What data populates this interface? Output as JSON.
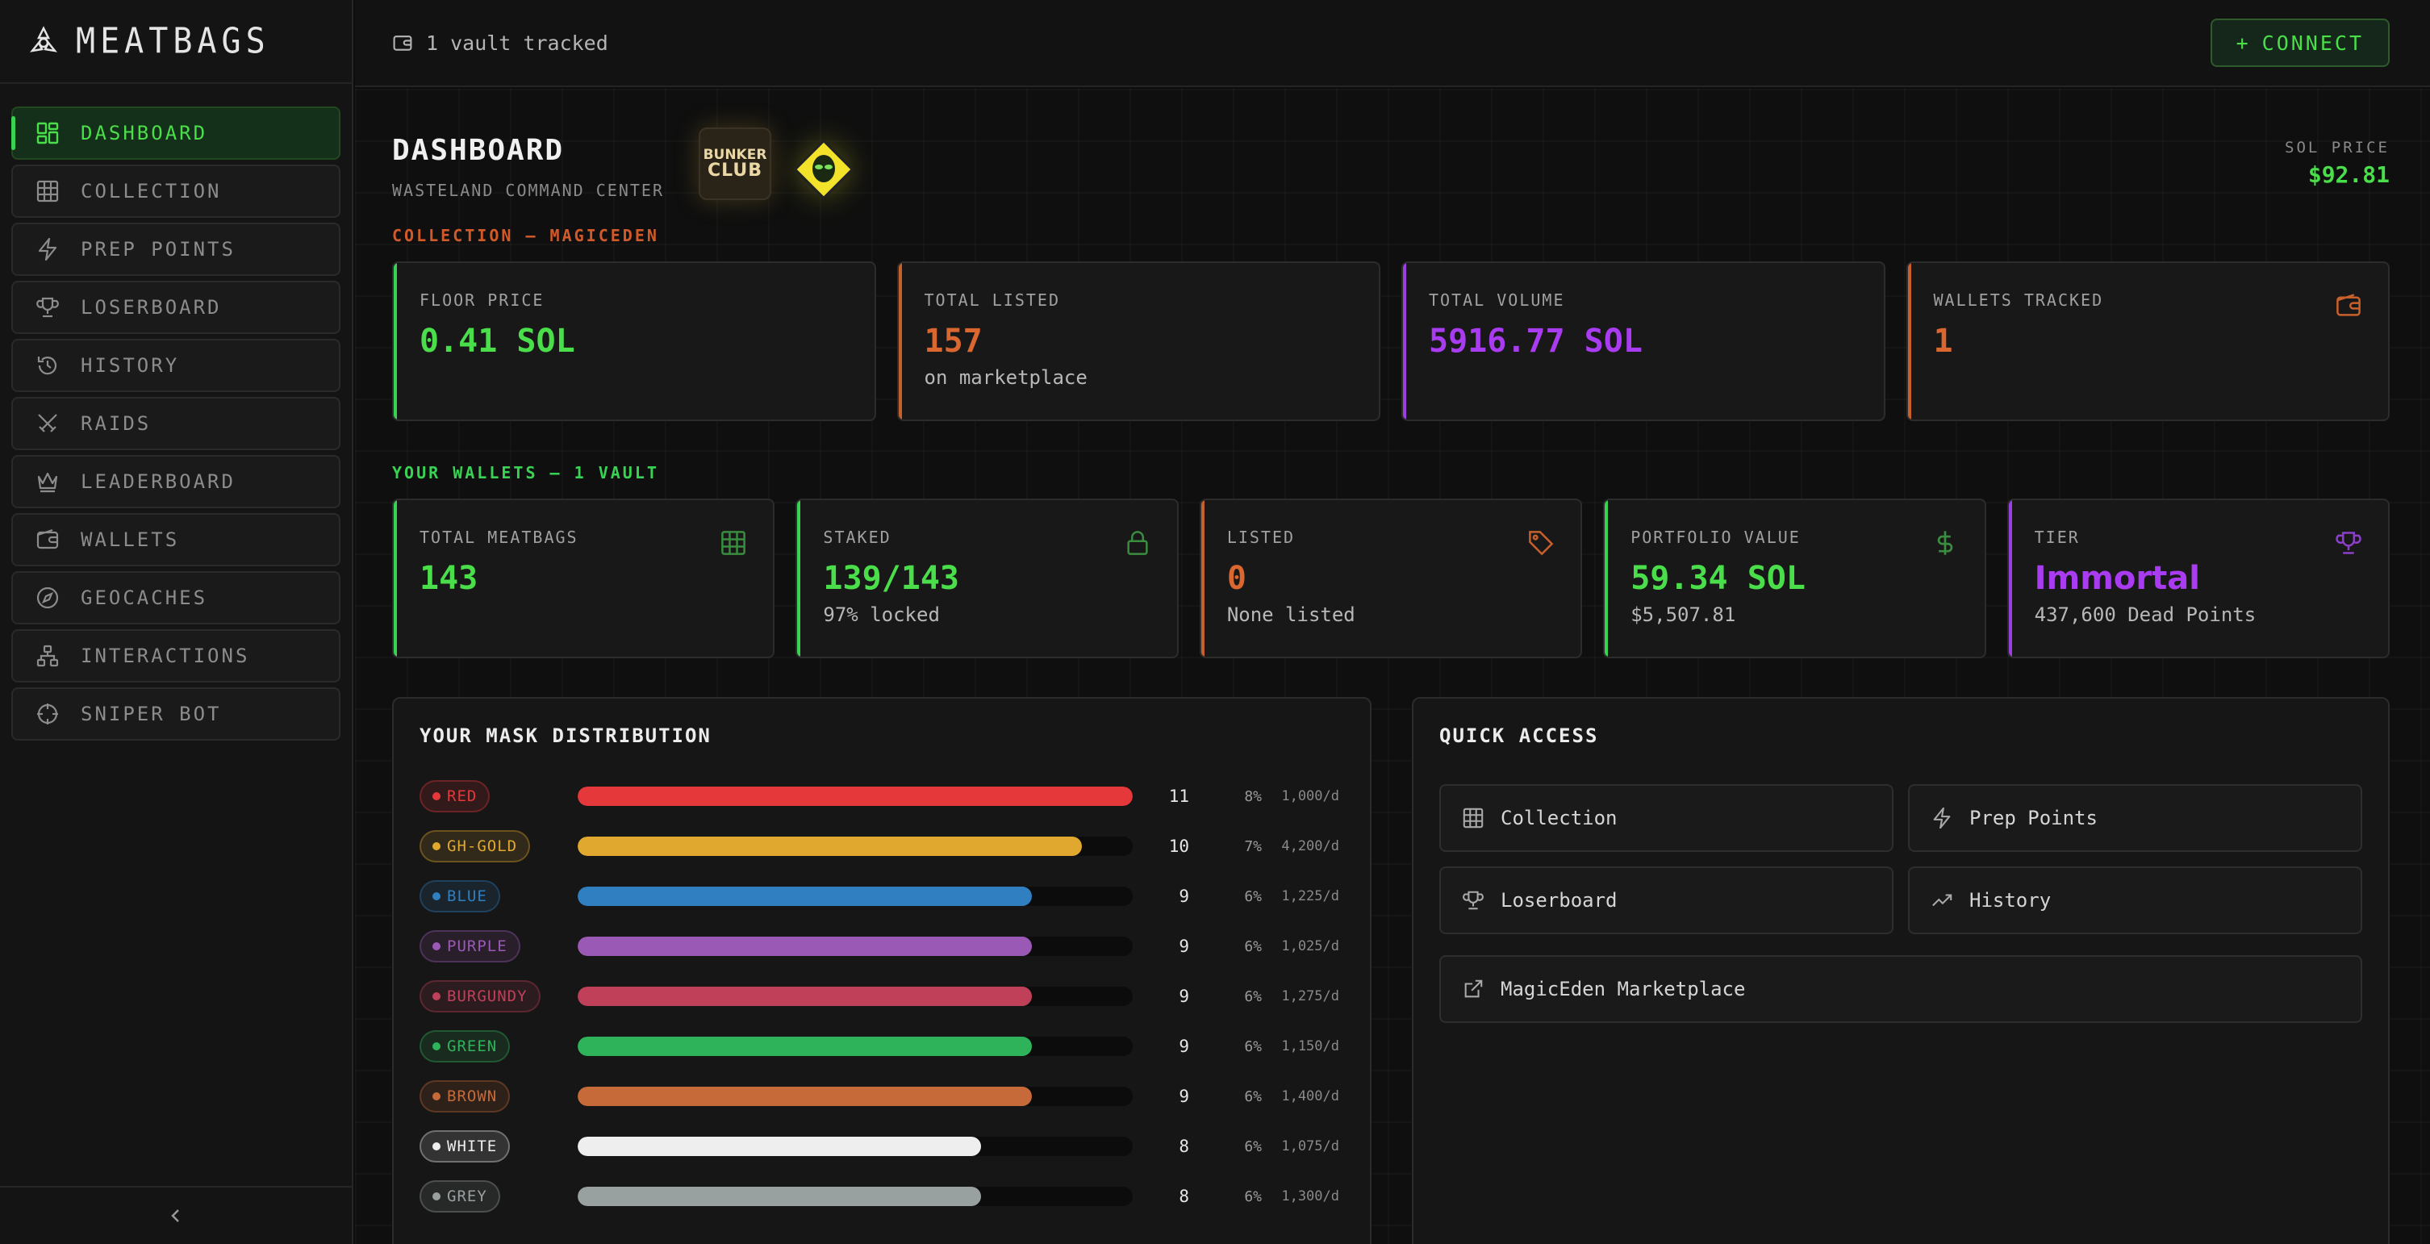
{
  "brand": {
    "name": "MEATBAGS"
  },
  "sidebar": {
    "items": [
      {
        "label": "DASHBOARD",
        "icon": "dashboard-icon",
        "active": true
      },
      {
        "label": "COLLECTION",
        "icon": "grid-icon"
      },
      {
        "label": "PREP POINTS",
        "icon": "lightning-icon"
      },
      {
        "label": "LOSERBOARD",
        "icon": "trophy-icon"
      },
      {
        "label": "HISTORY",
        "icon": "history-icon"
      },
      {
        "label": "RAIDS",
        "icon": "swords-icon"
      },
      {
        "label": "LEADERBOARD",
        "icon": "crown-icon"
      },
      {
        "label": "WALLETS",
        "icon": "wallet-icon"
      },
      {
        "label": "GEOCACHES",
        "icon": "compass-icon"
      },
      {
        "label": "INTERACTIONS",
        "icon": "network-icon"
      },
      {
        "label": "SNIPER BOT",
        "icon": "crosshair-icon"
      }
    ],
    "collapse_icon": "chevron-left-icon"
  },
  "topbar": {
    "vault_text": "1 vault tracked",
    "connect_label": "CONNECT"
  },
  "header": {
    "title": "DASHBOARD",
    "subtitle": "WASTELAND COMMAND CENTER",
    "badge_top": "BUNKER",
    "badge_bottom": "CLUB",
    "sol_price_label": "SOL PRICE",
    "sol_price_value": "$92.81"
  },
  "collection": {
    "section_label": "COLLECTION — MAGICEDEN",
    "cards": [
      {
        "label": "FLOOR PRICE",
        "value": "0.41 SOL",
        "sub": "",
        "accent": "green"
      },
      {
        "label": "TOTAL LISTED",
        "value": "157",
        "sub": "on marketplace",
        "accent": "orange"
      },
      {
        "label": "TOTAL VOLUME",
        "value": "5916.77 SOL",
        "sub": "",
        "accent": "purple"
      },
      {
        "label": "WALLETS TRACKED",
        "value": "1",
        "sub": "",
        "accent": "orange",
        "icon": "wallet-icon"
      }
    ]
  },
  "wallets": {
    "section_label": "YOUR WALLETS — 1 VAULT",
    "cards": [
      {
        "label": "TOTAL MEATBAGS",
        "value": "143",
        "sub": "",
        "accent": "green",
        "icon": "grid-icon"
      },
      {
        "label": "STAKED",
        "value": "139/143",
        "sub": "97% locked",
        "accent": "green",
        "icon": "lock-icon"
      },
      {
        "label": "LISTED",
        "value": "0",
        "sub": "None listed",
        "accent": "orange",
        "icon": "tag-icon"
      },
      {
        "label": "PORTFOLIO VALUE",
        "value": "59.34 SOL",
        "sub": "$5,507.81",
        "accent": "green",
        "icon": "dollar-icon"
      },
      {
        "label": "TIER",
        "value": "Immortal",
        "sub": "437,600 Dead Points",
        "accent": "purple",
        "icon": "trophy-icon"
      }
    ]
  },
  "mask_distribution": {
    "title": "YOUR MASK DISTRIBUTION",
    "max_count": 11,
    "rows": [
      {
        "name": "RED",
        "count": "11",
        "pct": "8%",
        "rate": "1,000/d",
        "color": "#e5383b"
      },
      {
        "name": "GH-GOLD",
        "count": "10",
        "pct": "7%",
        "rate": "4,200/d",
        "color": "#e0a82e"
      },
      {
        "name": "BLUE",
        "count": "9",
        "pct": "6%",
        "rate": "1,225/d",
        "color": "#2f7fc1"
      },
      {
        "name": "PURPLE",
        "count": "9",
        "pct": "6%",
        "rate": "1,025/d",
        "color": "#9b59b6"
      },
      {
        "name": "BURGUNDY",
        "count": "9",
        "pct": "6%",
        "rate": "1,275/d",
        "color": "#c0405a"
      },
      {
        "name": "GREEN",
        "count": "9",
        "pct": "6%",
        "rate": "1,150/d",
        "color": "#2fb35a"
      },
      {
        "name": "BROWN",
        "count": "9",
        "pct": "6%",
        "rate": "1,400/d",
        "color": "#c56a38"
      },
      {
        "name": "WHITE",
        "count": "8",
        "pct": "6%",
        "rate": "1,075/d",
        "color": "#eeeeee"
      },
      {
        "name": "GREY",
        "count": "8",
        "pct": "6%",
        "rate": "1,300/d",
        "color": "#98a0a0"
      }
    ]
  },
  "quick_access": {
    "title": "QUICK ACCESS",
    "items": [
      {
        "label": "Collection",
        "icon": "grid-icon"
      },
      {
        "label": "Prep Points",
        "icon": "lightning-icon"
      },
      {
        "label": "Loserboard",
        "icon": "trophy-icon"
      },
      {
        "label": "History",
        "icon": "trending-up-icon"
      },
      {
        "label": "MagicEden Marketplace",
        "icon": "external-link-icon",
        "wide": true
      }
    ]
  }
}
